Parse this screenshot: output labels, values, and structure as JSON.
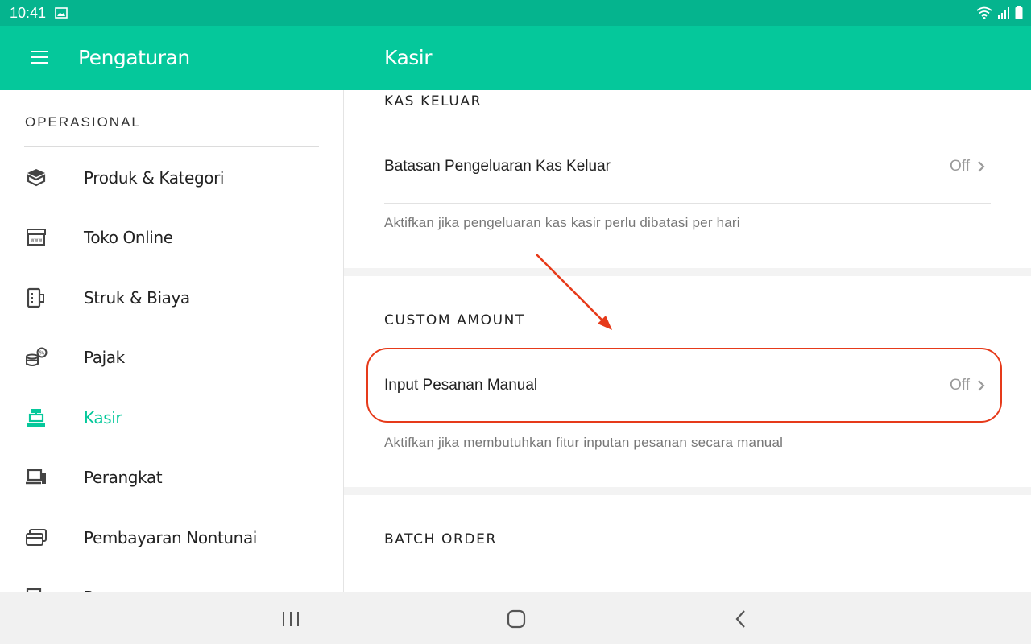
{
  "status_bar": {
    "time": "10:41"
  },
  "app_bar": {
    "title": "Pengaturan",
    "detail_title": "Kasir"
  },
  "sidebar": {
    "section": "OPERASIONAL",
    "items": [
      {
        "label": "Produk & Kategori",
        "icon": "box-icon"
      },
      {
        "label": "Toko Online",
        "icon": "storefront-icon"
      },
      {
        "label": "Struk & Biaya",
        "icon": "receipt-icon"
      },
      {
        "label": "Pajak",
        "icon": "tax-coins-icon"
      },
      {
        "label": "Kasir",
        "icon": "cashier-icon",
        "active": true
      },
      {
        "label": "Perangkat",
        "icon": "device-icon"
      },
      {
        "label": "Pembayaran Nontunai",
        "icon": "card-icon"
      },
      {
        "label": "P",
        "icon": "more-icon"
      }
    ]
  },
  "main": {
    "kas_keluar": {
      "header": "KAS KELUAR",
      "row_label": "Batasan Pengeluaran Kas Keluar",
      "row_value": "Off",
      "helper": "Aktifkan jika pengeluaran kas kasir perlu dibatasi per hari"
    },
    "custom_amount": {
      "header": "CUSTOM AMOUNT",
      "row_label": "Input Pesanan Manual",
      "row_value": "Off",
      "helper": "Aktifkan jika membutuhkan fitur inputan pesanan secara manual"
    },
    "batch_order": {
      "header": "BATCH ORDER"
    }
  },
  "colors": {
    "primary": "#05c89b",
    "status_bar": "#05b48e",
    "annotation": "#e63a1a"
  }
}
